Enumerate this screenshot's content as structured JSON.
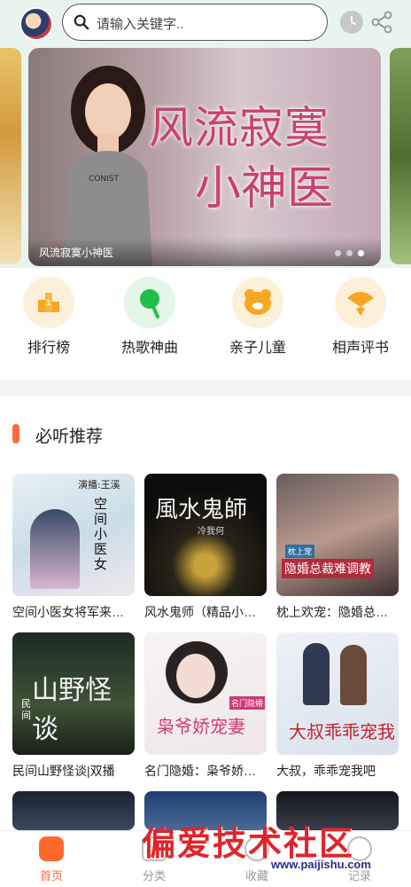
{
  "header": {
    "search_placeholder": "请输入关键字.."
  },
  "banner": {
    "title_line1": "风流寂寞",
    "title_line2": "小神医",
    "caption": "风流寂寞小神医",
    "slide_count": 3,
    "active_slide": 3
  },
  "categories": [
    {
      "label": "排行榜",
      "icon": "ranking-icon",
      "color": "#f6a623"
    },
    {
      "label": "热歌神曲",
      "icon": "microphone-icon",
      "color": "#1fbf4a"
    },
    {
      "label": "亲子儿童",
      "icon": "bear-icon",
      "color": "#f7a823"
    },
    {
      "label": "相声评书",
      "icon": "fan-icon",
      "color": "#f6a623"
    }
  ],
  "section": {
    "title": "必听推荐"
  },
  "books": [
    {
      "title": "空间小医女将军来种田",
      "cover_text": "空间小医女",
      "cover_sub": "演播:王溪"
    },
    {
      "title": "风水鬼师（精品小说）",
      "cover_text": "風水鬼師",
      "cover_sub": "冷我何"
    },
    {
      "title": "枕上欢宠：隐婚总裁难调教",
      "cover_text": "隐婚总裁难调教",
      "cover_sub": "枕上宠"
    },
    {
      "title": "民间山野怪谈|双播",
      "cover_text": "山野怪谈",
      "cover_sub": "民间"
    },
    {
      "title": "名门隐婚：枭爷娇宠妻",
      "cover_text": "枭爷娇宠妻",
      "cover_sub": "名门隐婚"
    },
    {
      "title": "大叔，乖乖宠我吧",
      "cover_text": "大叔乖乖宠我",
      "cover_sub": ""
    }
  ],
  "nav": {
    "items": [
      {
        "label": "首页",
        "active": true
      },
      {
        "label": "分类",
        "active": false
      },
      {
        "label": "收藏",
        "active": false
      },
      {
        "label": "记录",
        "active": false
      }
    ]
  },
  "watermark": {
    "text": "偏爱技术社区",
    "url": "www.paijishu.com"
  },
  "colors": {
    "accent": "#ff6a2a",
    "header_bg": "#e9f4ee"
  }
}
